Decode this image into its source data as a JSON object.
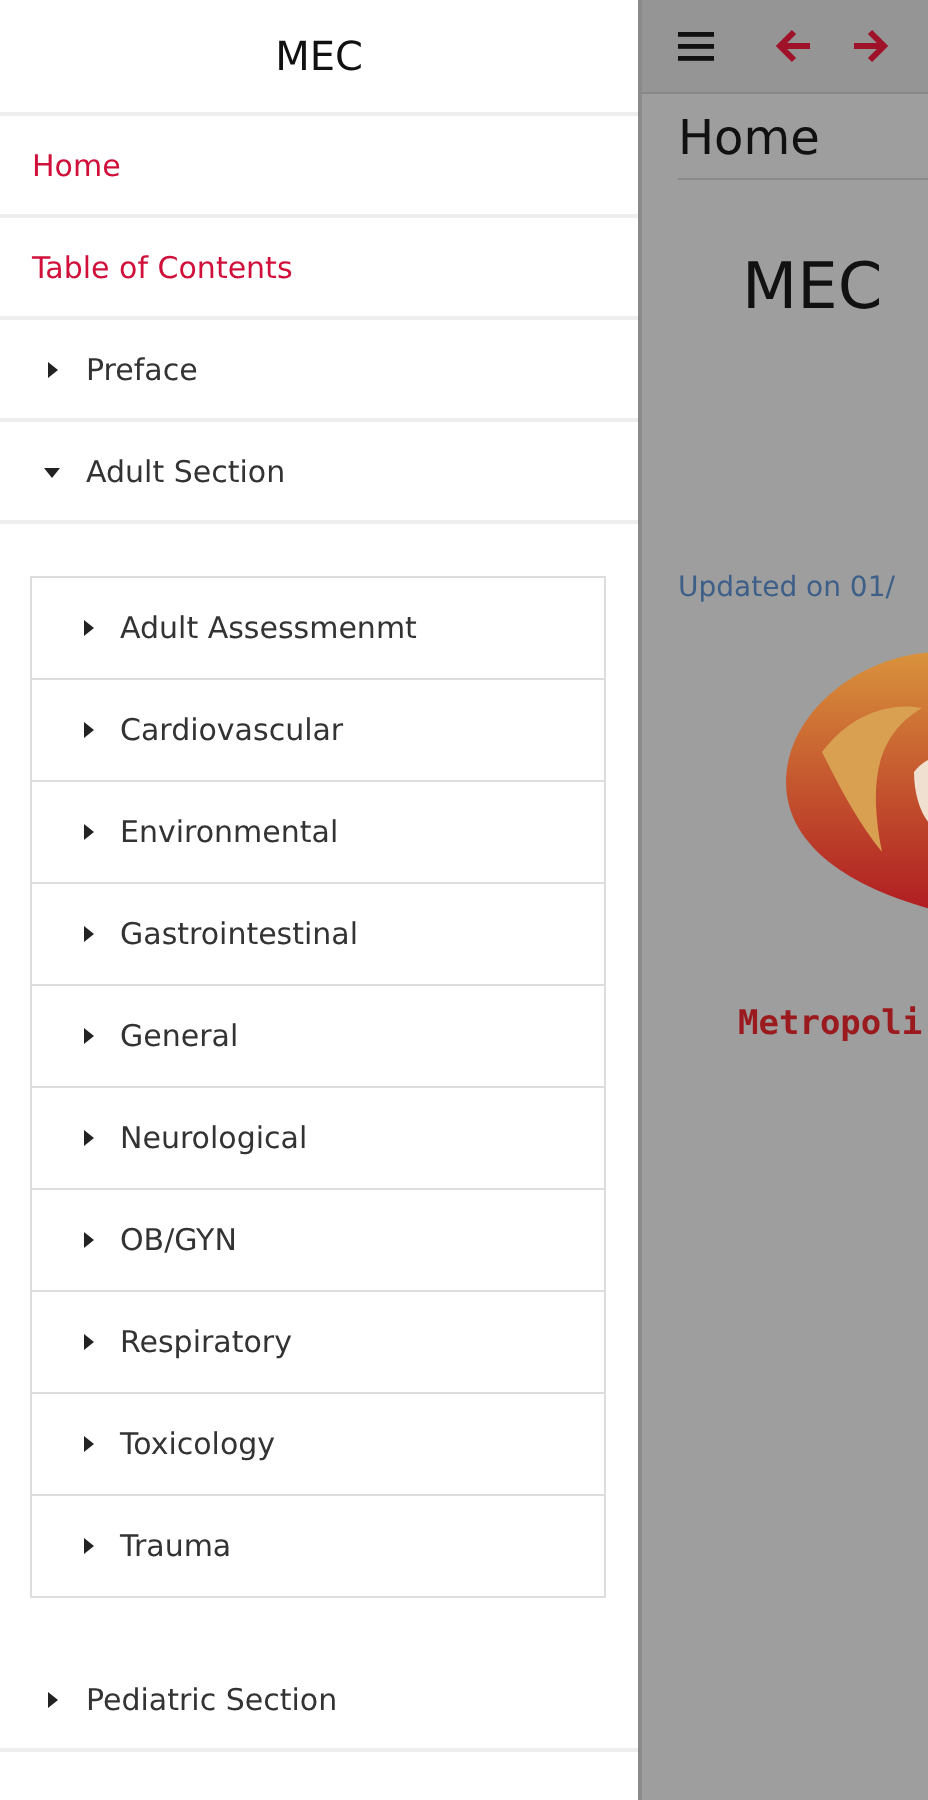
{
  "drawer": {
    "title": "MEC",
    "items": [
      {
        "label": "Home",
        "kind": "link"
      },
      {
        "label": "Table of Contents",
        "kind": "link"
      },
      {
        "label": "Preface",
        "kind": "section",
        "expanded": false
      },
      {
        "label": "Adult Section",
        "kind": "section",
        "expanded": true,
        "children": [
          {
            "label": "Adult Assessmenmt",
            "expanded": false
          },
          {
            "label": "Cardiovascular",
            "expanded": false
          },
          {
            "label": "Environmental",
            "expanded": false
          },
          {
            "label": "Gastrointestinal",
            "expanded": false
          },
          {
            "label": "General",
            "expanded": false
          },
          {
            "label": "Neurological",
            "expanded": false
          },
          {
            "label": "OB/GYN",
            "expanded": false
          },
          {
            "label": "Respiratory",
            "expanded": false
          },
          {
            "label": "Toxicology",
            "expanded": false
          },
          {
            "label": "Trauma",
            "expanded": false
          }
        ]
      },
      {
        "label": "Pediatric Section",
        "kind": "section",
        "expanded": false
      }
    ]
  },
  "content": {
    "page_title": "Home",
    "heading": "MEC",
    "updated": "Updated on 01/",
    "logo_text": "Metropoli"
  }
}
